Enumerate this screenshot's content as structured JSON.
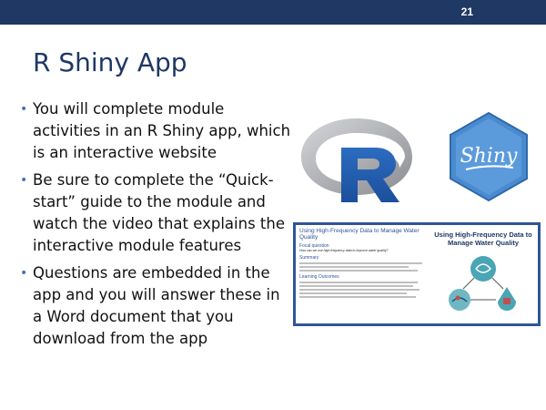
{
  "slide": {
    "page_number": "21",
    "title": "R Shiny App",
    "bullets": [
      "You will complete module activities in an R Shiny app, which is an interactive website",
      "Be sure to complete the “Quick-start” guide to the module and watch the video that explains the interactive module features",
      "Questions are embedded in the app and you will answer these in a Word document that you download from the app"
    ],
    "logos": {
      "r": "R",
      "shiny": "Shiny"
    },
    "thumbnail": {
      "title": "Using High-Frequency Data to Manage Water Quality",
      "focal_heading": "Focal question",
      "focal_question": "How can we use high-frequency data to improve water quality?",
      "summary_heading": "Summary",
      "outcomes_heading": "Learning Outcomes",
      "right_title": "Using High-Frequency Data to Manage Water Quality"
    }
  },
  "colors": {
    "header": "#1f3864",
    "title": "#1f3864",
    "bullet": "#4472c4",
    "frame": "#2f5597"
  }
}
